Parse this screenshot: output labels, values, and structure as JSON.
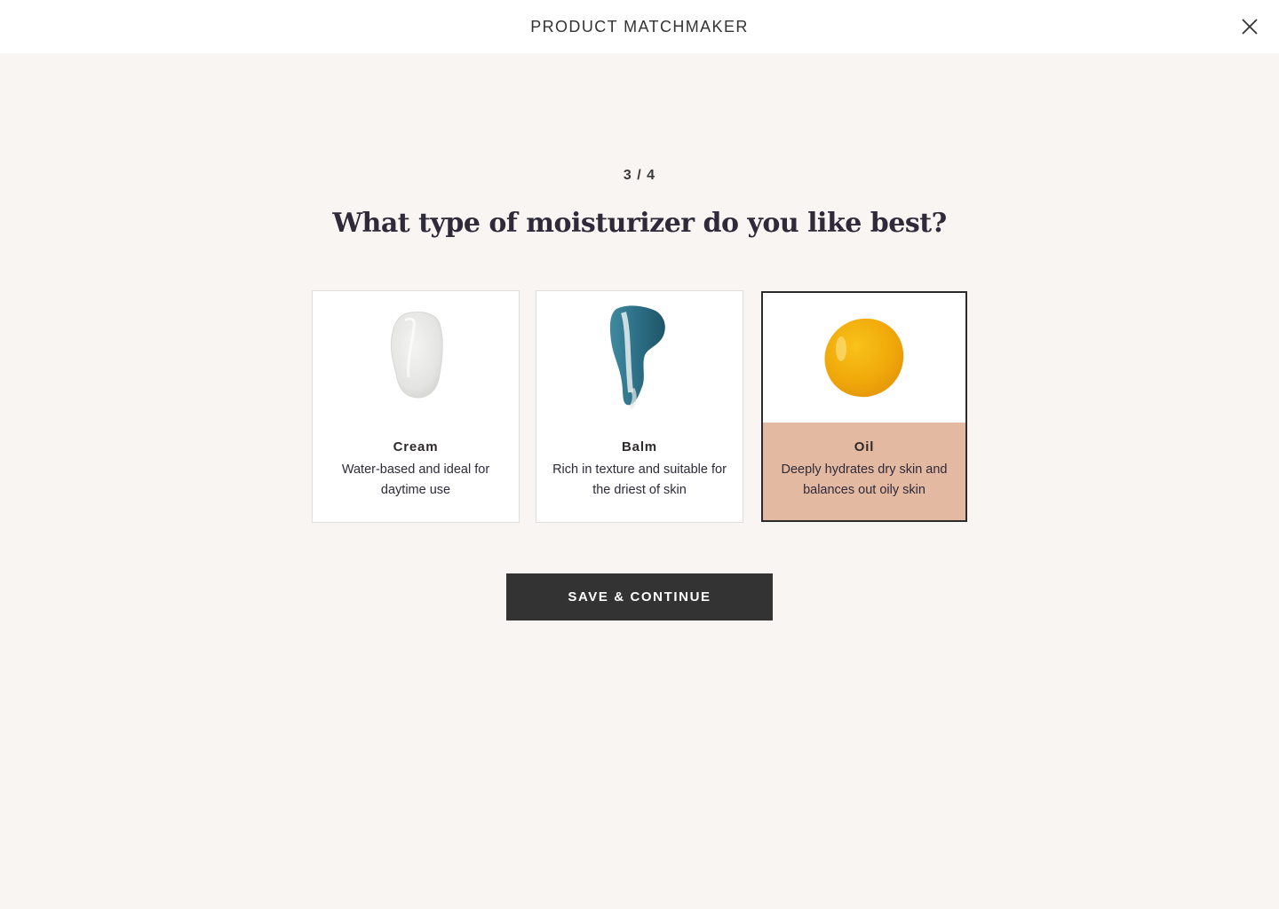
{
  "header": {
    "title": "PRODUCT MATCHMAKER",
    "close_icon": "close-icon"
  },
  "quiz": {
    "step": "3 / 4",
    "question": "What type of moisturizer do you like best?",
    "options": [
      {
        "title": "Cream",
        "description": "Water-based and ideal for daytime use",
        "swatch": "cream-swatch-icon",
        "selected": false
      },
      {
        "title": "Balm",
        "description": "Rich in texture and suitable for the driest of skin",
        "swatch": "balm-swatch-icon",
        "selected": false
      },
      {
        "title": "Oil",
        "description": "Deeply hydrates dry skin and balances out oily skin",
        "swatch": "oil-swatch-icon",
        "selected": true
      }
    ],
    "cta_label": "SAVE & CONTINUE"
  },
  "colors": {
    "page_background": "#f8f5f2",
    "selected_highlight": "#e3b9a2",
    "button_background": "#333333"
  }
}
